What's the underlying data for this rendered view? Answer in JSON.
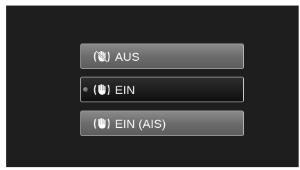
{
  "menu": {
    "options": [
      {
        "label": "AUS",
        "icon": "stabilizer-off-icon",
        "selected": false
      },
      {
        "label": "EIN",
        "icon": "stabilizer-on-icon",
        "selected": true
      },
      {
        "label": "EIN (AIS)",
        "icon": "stabilizer-ais-icon",
        "selected": false
      }
    ]
  },
  "colors": {
    "screen_background": "#1e1e1e",
    "option_normal": "#6a6a6a",
    "option_selected": "#0e0e0e",
    "text": "#ffffff"
  }
}
